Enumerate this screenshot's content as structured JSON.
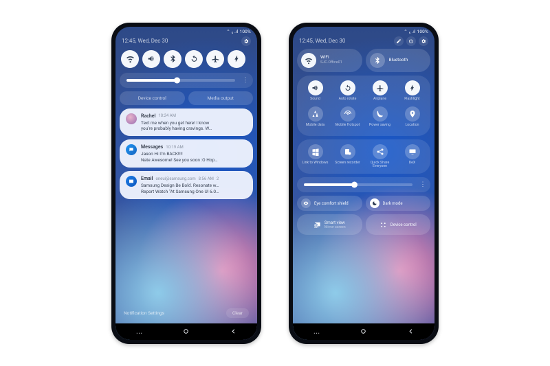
{
  "status": "⌃ ₅ .ıl 100%",
  "datetime": "12:45, Wed, Dec 30",
  "left": {
    "quick": [
      "wifi",
      "sound",
      "bluetooth",
      "rotate",
      "airplane",
      "flashlight"
    ],
    "pills": [
      "Device control",
      "Media output"
    ],
    "notifications": [
      {
        "avatar": "img",
        "app": "Rachel",
        "ts": "10:24 AM",
        "lines": [
          "Text me when you get here! I know",
          "you're probably having cravings. W…"
        ]
      },
      {
        "avatar": "msg",
        "app": "Messages",
        "ts": "10:19 AM",
        "lines": [
          "Jason  Hi I'm BACK!!!!",
          "Nate  Awesome! See you soon :O Hop…"
        ]
      },
      {
        "avatar": "mail",
        "app": "Email",
        "from": "oneui@samsung.com",
        "ts": "8:56 AM",
        "count": "2",
        "lines": [
          "Samsung Design  Be Bold. Resonate w…",
          "Report  Watch \"At Samsung One UI 6.0…"
        ]
      }
    ],
    "footer_settings": "Notification Settings",
    "footer_clear": "Clear"
  },
  "right": {
    "wifi": {
      "label": "WiFi",
      "sub": "SJC.Office01",
      "on": true
    },
    "bt": {
      "label": "Bluetooth",
      "on": false
    },
    "grid1": [
      {
        "k": "sound",
        "l": "Sound",
        "on": true
      },
      {
        "k": "rotate",
        "l": "Auto rotate",
        "on": true
      },
      {
        "k": "airplane",
        "l": "Airplane",
        "on": true
      },
      {
        "k": "flashlight",
        "l": "Flashlight",
        "on": true
      },
      {
        "k": "mdata",
        "l": "Mobile data",
        "on": false
      },
      {
        "k": "hotspot",
        "l": "Mobile Hotspot",
        "on": false
      },
      {
        "k": "psave",
        "l": "Power saving",
        "on": false
      },
      {
        "k": "location",
        "l": "Location",
        "on": false
      }
    ],
    "grid2": [
      {
        "k": "linkwin",
        "l": "Link to Windows",
        "on": false
      },
      {
        "k": "srec",
        "l": "Screen recorder",
        "on": false
      },
      {
        "k": "qshare",
        "l": "Quick Share Everyone",
        "on": false
      },
      {
        "k": "dex",
        "l": "DeX",
        "on": false
      }
    ],
    "eye": "Eye comfort shield",
    "dark": "Dark mode",
    "smart": {
      "label": "Smart view",
      "sub": "Mirror screen"
    },
    "devctrl": "Device control"
  }
}
